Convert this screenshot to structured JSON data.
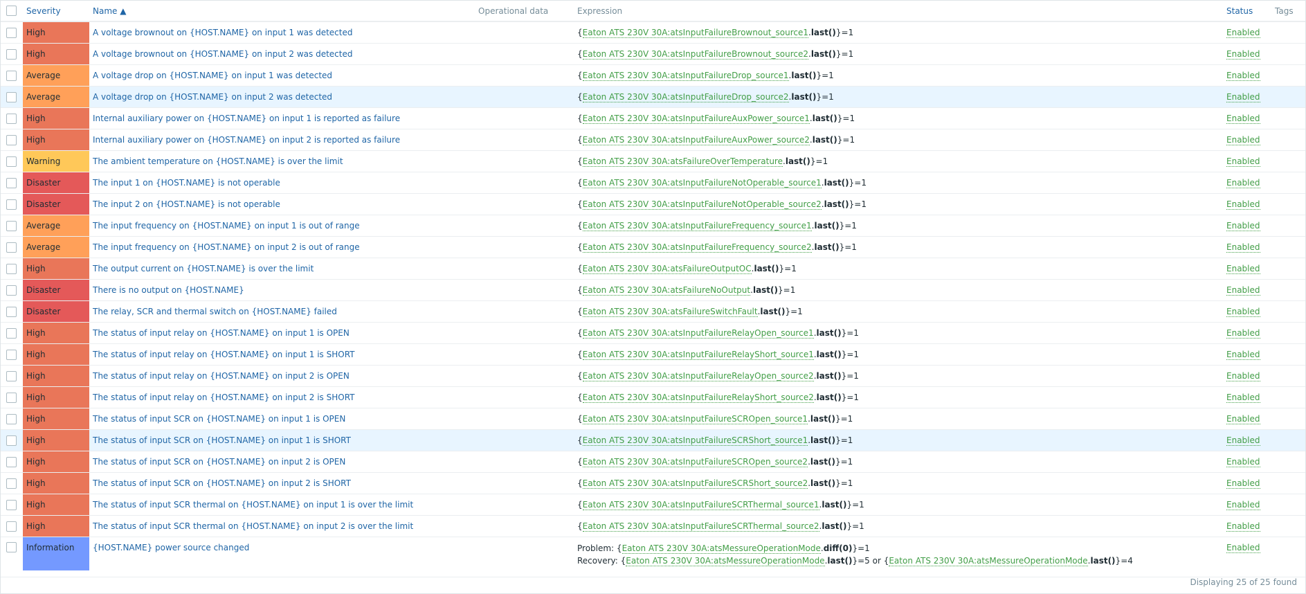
{
  "headers": {
    "severity": "Severity",
    "name": "Name ▲",
    "operational_data": "Operational data",
    "expression": "Expression",
    "status": "Status",
    "tags": "Tags"
  },
  "severity_colors": {
    "High": "#e97659",
    "Average": "#ffa059",
    "Warning": "#ffc859",
    "Disaster": "#e45959",
    "Information": "#7499ff"
  },
  "rows": [
    {
      "severity": "High",
      "name": "A voltage brownout on {HOST.NAME} on input 1 was detected",
      "item": "Eaton ATS 230V 30A:atsInputFailureBrownout_source1",
      "fn": "last()",
      "tail": "=1",
      "status": "Enabled"
    },
    {
      "severity": "High",
      "name": "A voltage brownout on {HOST.NAME} on input 2 was detected",
      "item": "Eaton ATS 230V 30A:atsInputFailureBrownout_source2",
      "fn": "last()",
      "tail": "=1",
      "status": "Enabled"
    },
    {
      "severity": "Average",
      "name": "A voltage drop on {HOST.NAME} on input 1 was detected",
      "item": "Eaton ATS 230V 30A:atsInputFailureDrop_source1",
      "fn": "last()",
      "tail": "=1",
      "status": "Enabled"
    },
    {
      "severity": "Average",
      "name": "A voltage drop on {HOST.NAME} on input 2 was detected",
      "item": "Eaton ATS 230V 30A:atsInputFailureDrop_source2",
      "fn": "last()",
      "tail": "=1",
      "status": "Enabled",
      "hl": true
    },
    {
      "severity": "High",
      "name": "Internal auxiliary power on {HOST.NAME} on input 1 is reported as failure",
      "item": "Eaton ATS 230V 30A:atsInputFailureAuxPower_source1",
      "fn": "last()",
      "tail": "=1",
      "status": "Enabled"
    },
    {
      "severity": "High",
      "name": "Internal auxiliary power on {HOST.NAME} on input 2 is reported as failure",
      "item": "Eaton ATS 230V 30A:atsInputFailureAuxPower_source2",
      "fn": "last()",
      "tail": "=1",
      "status": "Enabled"
    },
    {
      "severity": "Warning",
      "name": "The ambient temperature on {HOST.NAME} is over the limit",
      "item": "Eaton ATS 230V 30A:atsFailureOverTemperature",
      "fn": "last()",
      "tail": "=1",
      "status": "Enabled"
    },
    {
      "severity": "Disaster",
      "name": "The input 1 on {HOST.NAME} is not operable",
      "item": "Eaton ATS 230V 30A:atsInputFailureNotOperable_source1",
      "fn": "last()",
      "tail": "=1",
      "status": "Enabled"
    },
    {
      "severity": "Disaster",
      "name": "The input 2 on {HOST.NAME} is not operable",
      "item": "Eaton ATS 230V 30A:atsInputFailureNotOperable_source2",
      "fn": "last()",
      "tail": "=1",
      "status": "Enabled"
    },
    {
      "severity": "Average",
      "name": "The input frequency on {HOST.NAME} on input 1 is out of range",
      "item": "Eaton ATS 230V 30A:atsInputFailureFrequency_source1",
      "fn": "last()",
      "tail": "=1",
      "status": "Enabled"
    },
    {
      "severity": "Average",
      "name": "The input frequency on {HOST.NAME} on input 2 is out of range",
      "item": "Eaton ATS 230V 30A:atsInputFailureFrequency_source2",
      "fn": "last()",
      "tail": "=1",
      "status": "Enabled"
    },
    {
      "severity": "High",
      "name": "The output current on {HOST.NAME} is over the limit",
      "item": "Eaton ATS 230V 30A:atsFailureOutputOC",
      "fn": "last()",
      "tail": "=1",
      "status": "Enabled"
    },
    {
      "severity": "Disaster",
      "name": "There is no output on {HOST.NAME}",
      "item": "Eaton ATS 230V 30A:atsFailureNoOutput",
      "fn": "last()",
      "tail": "=1",
      "status": "Enabled"
    },
    {
      "severity": "Disaster",
      "name": "The relay, SCR and thermal switch on {HOST.NAME} failed",
      "item": "Eaton ATS 230V 30A:atsFailureSwitchFault",
      "fn": "last()",
      "tail": "=1",
      "status": "Enabled"
    },
    {
      "severity": "High",
      "name": "The status of input relay on {HOST.NAME} on input 1 is OPEN",
      "item": "Eaton ATS 230V 30A:atsInputFailureRelayOpen_source1",
      "fn": "last()",
      "tail": "=1",
      "status": "Enabled"
    },
    {
      "severity": "High",
      "name": "The status of input relay on {HOST.NAME} on input 1 is SHORT",
      "item": "Eaton ATS 230V 30A:atsInputFailureRelayShort_source1",
      "fn": "last()",
      "tail": "=1",
      "status": "Enabled"
    },
    {
      "severity": "High",
      "name": "The status of input relay on {HOST.NAME} on input 2 is OPEN",
      "item": "Eaton ATS 230V 30A:atsInputFailureRelayOpen_source2",
      "fn": "last()",
      "tail": "=1",
      "status": "Enabled"
    },
    {
      "severity": "High",
      "name": "The status of input relay on {HOST.NAME} on input 2 is SHORT",
      "item": "Eaton ATS 230V 30A:atsInputFailureRelayShort_source2",
      "fn": "last()",
      "tail": "=1",
      "status": "Enabled"
    },
    {
      "severity": "High",
      "name": "The status of input SCR on {HOST.NAME} on input 1 is OPEN",
      "item": "Eaton ATS 230V 30A:atsInputFailureSCROpen_source1",
      "fn": "last()",
      "tail": "=1",
      "status": "Enabled"
    },
    {
      "severity": "High",
      "name": "The status of input SCR on {HOST.NAME} on input 1 is SHORT",
      "item": "Eaton ATS 230V 30A:atsInputFailureSCRShort_source1",
      "fn": "last()",
      "tail": "=1",
      "status": "Enabled",
      "hl": true
    },
    {
      "severity": "High",
      "name": "The status of input SCR on {HOST.NAME} on input 2 is OPEN",
      "item": "Eaton ATS 230V 30A:atsInputFailureSCROpen_source2",
      "fn": "last()",
      "tail": "=1",
      "status": "Enabled"
    },
    {
      "severity": "High",
      "name": "The status of input SCR on {HOST.NAME} on input 2 is SHORT",
      "item": "Eaton ATS 230V 30A:atsInputFailureSCRShort_source2",
      "fn": "last()",
      "tail": "=1",
      "status": "Enabled"
    },
    {
      "severity": "High",
      "name": "The status of input SCR thermal on {HOST.NAME} on input 1 is over the limit",
      "item": "Eaton ATS 230V 30A:atsInputFailureSCRThermal_source1",
      "fn": "last()",
      "tail": "=1",
      "status": "Enabled"
    },
    {
      "severity": "High",
      "name": "The status of input SCR thermal on {HOST.NAME} on input 2 is over the limit",
      "item": "Eaton ATS 230V 30A:atsInputFailureSCRThermal_source2",
      "fn": "last()",
      "tail": "=1",
      "status": "Enabled"
    }
  ],
  "last_row": {
    "severity": "Information",
    "name": "{HOST.NAME} power source changed",
    "problem_label": "Problem: ",
    "problem_item": "Eaton ATS 230V 30A:atsMessureOperationMode",
    "problem_fn": "diff(0)",
    "problem_tail": "=1",
    "recovery_label": "Recovery: ",
    "recovery_item1": "Eaton ATS 230V 30A:atsMessureOperationMode",
    "recovery_fn1": "last()",
    "recovery_mid": "=5 or ",
    "recovery_item2": "Eaton ATS 230V 30A:atsMessureOperationMode",
    "recovery_fn2": "last()",
    "recovery_tail": "=4",
    "status": "Enabled"
  },
  "footer": "Displaying 25 of 25 found"
}
